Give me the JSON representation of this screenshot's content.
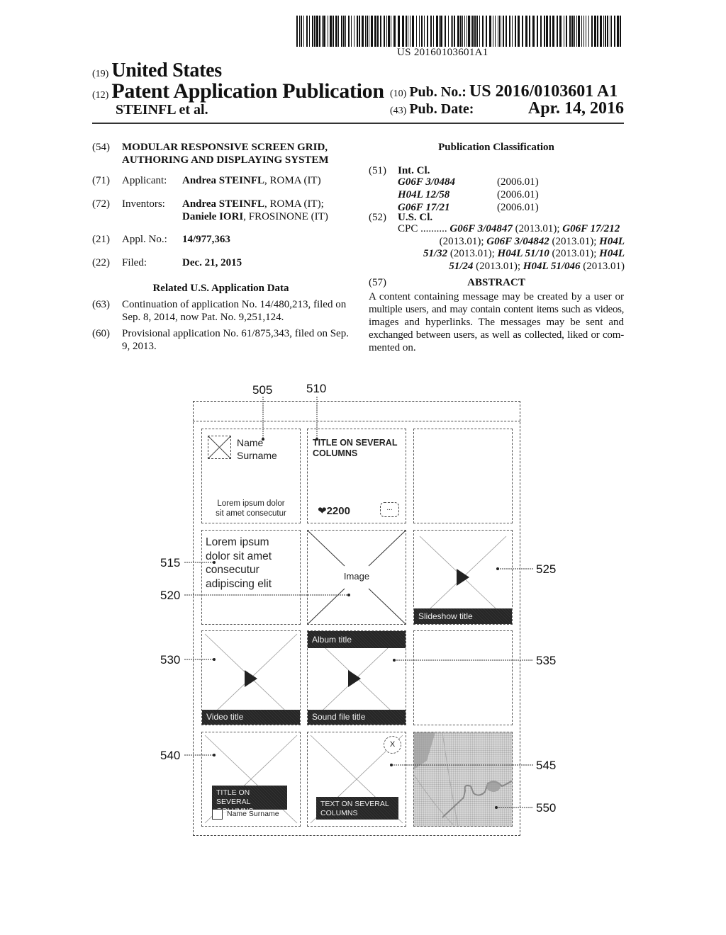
{
  "header": {
    "barcode_number": "US 20160103601A1",
    "country_tag": "(19)",
    "country": "United States",
    "type_tag": "(12)",
    "type": "Patent Application Publication",
    "authors": "STEINFL et al.",
    "pub_no_tag": "(10)",
    "pub_no_label": "Pub. No.:",
    "pub_no": "US 2016/0103601 A1",
    "pub_date_tag": "(43)",
    "pub_date_label": "Pub. Date:",
    "pub_date": "Apr. 14, 2016"
  },
  "biblio": {
    "title_tag": "(54)",
    "title_line1": "MODULAR RESPONSIVE SCREEN GRID,",
    "title_line2": "AUTHORING AND DISPLAYING SYSTEM",
    "applicant_tag": "(71)",
    "applicant_label": "Applicant:",
    "applicant_name": "Andrea STEINFL",
    "applicant_loc": ", ROMA (IT)",
    "inventors_tag": "(72)",
    "inventors_label": "Inventors:",
    "inventor1_name": "Andrea STEINFL",
    "inventor1_loc": ", ROMA (IT);",
    "inventor2_name": "Daniele IORI",
    "inventor2_loc": ", FROSINONE (IT)",
    "appl_tag": "(21)",
    "appl_label": "Appl. No.:",
    "appl_no": "14/977,363",
    "filed_tag": "(22)",
    "filed_label": "Filed:",
    "filed_date": "Dec. 21, 2015",
    "related_heading": "Related U.S. Application Data",
    "cont_tag": "(63)",
    "cont_line1": "Continuation of application No. 14/480,213, filed on",
    "cont_line2": "Sep. 8, 2014, now Pat. No. 9,251,124.",
    "prov_tag": "(60)",
    "prov_line1": "Provisional application No. 61/875,343, filed on Sep.",
    "prov_line2": "9, 2013."
  },
  "classification": {
    "heading": "Publication Classification",
    "intcl_tag": "(51)",
    "intcl_label": "Int. Cl.",
    "intcl": [
      {
        "code": "G06F 3/0484",
        "version": "(2006.01)"
      },
      {
        "code": "H04L 12/58",
        "version": "(2006.01)"
      },
      {
        "code": "G06F 17/21",
        "version": "(2006.01)"
      }
    ],
    "uscl_tag": "(52)",
    "uscl_label": "U.S. Cl.",
    "cpc_label": "CPC ..........",
    "cpc": [
      {
        "code": "G06F 3/04847",
        "version": "(2013.01);"
      },
      {
        "code": "G06F 17/212",
        "version": "(2013.01);"
      },
      {
        "code": "G06F 3/04842",
        "version": "(2013.01);"
      },
      {
        "code": "H04L 51/32",
        "version": "(2013.01);"
      },
      {
        "code": "H04L 51/10",
        "version": "(2013.01);"
      },
      {
        "code": "H04L 51/24",
        "version": "(2013.01);"
      },
      {
        "code": "H04L 51/046",
        "version": "(2013.01)"
      }
    ]
  },
  "abstract": {
    "tag": "(57)",
    "heading": "ABSTRACT",
    "lines": [
      "A content containing message may be created by a user or",
      "multiple users, and may contain content items such as videos,",
      "images and hyperlinks. The messages may be sent and",
      "exchanged between users, as well as collected, liked or com-",
      "mented on."
    ]
  },
  "figure": {
    "refs": {
      "r505": "505",
      "r510": "510",
      "r515": "515",
      "r520": "520",
      "r525": "525",
      "r530": "530",
      "r535": "535",
      "r540": "540",
      "r545": "545",
      "r550": "550"
    },
    "profile_card": {
      "name": "Name",
      "surname": "Surname",
      "text_line1": "Lorem ipsum dolor",
      "text_line2": "sit amet consecutur"
    },
    "title_card": {
      "title_line1": "TITLE ON SEVERAL",
      "title_line2": "COLUMNS",
      "likes": "2200",
      "comment_icon": "..."
    },
    "text_card": {
      "lines": [
        "Lorem ipsum",
        "dolor sit amet",
        "consecutur",
        "adipiscing elit"
      ]
    },
    "image_card": {
      "label": "Image"
    },
    "slideshow_card": {
      "title": "Slideshow title"
    },
    "video_card": {
      "title": "Video title"
    },
    "sound_card": {
      "album": "Album title",
      "title": "Sound file title"
    },
    "overlay_card": {
      "title_line1": "TITLE ON SEVERAL",
      "title_line2": "COLUMNS",
      "author": "Name Surname"
    },
    "closable_card": {
      "close": "X",
      "text_line1": "TEXT ON SEVERAL",
      "text_line2": "COLUMNS"
    }
  }
}
